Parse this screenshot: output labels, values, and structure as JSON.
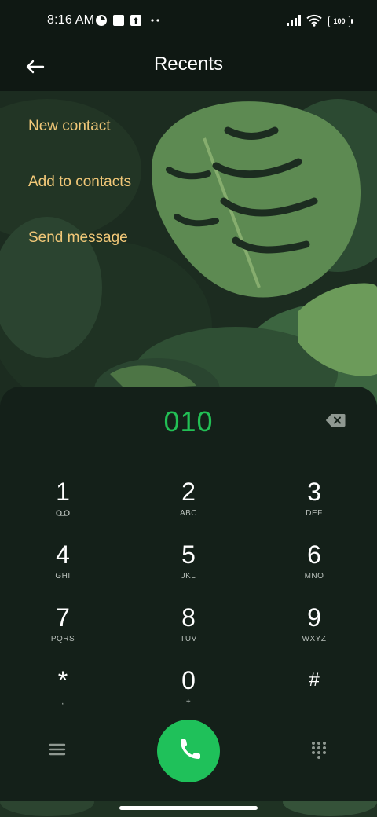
{
  "status_bar": {
    "time": "8:16 AM",
    "battery": "100",
    "icons": [
      "app-notification-icon",
      "square-notification-icon",
      "upload-icon",
      "more-dots-icon",
      "signal-icon",
      "wifi-icon",
      "battery-icon"
    ]
  },
  "header": {
    "title": "Recents",
    "back_icon": "arrow-left-icon"
  },
  "actions": [
    {
      "label": "New contact"
    },
    {
      "label": "Add to contacts"
    },
    {
      "label": "Send message"
    }
  ],
  "dialer": {
    "number": "010",
    "keys": [
      {
        "digit": "1",
        "sub": ""
      },
      {
        "digit": "2",
        "sub": "ABC"
      },
      {
        "digit": "3",
        "sub": "DEF"
      },
      {
        "digit": "4",
        "sub": "GHI"
      },
      {
        "digit": "5",
        "sub": "JKL"
      },
      {
        "digit": "6",
        "sub": "MNO"
      },
      {
        "digit": "7",
        "sub": "PQRS"
      },
      {
        "digit": "8",
        "sub": "TUV"
      },
      {
        "digit": "9",
        "sub": "WXYZ"
      },
      {
        "digit": "*",
        "sub": ","
      },
      {
        "digit": "0",
        "sub": "+"
      },
      {
        "digit": "#",
        "sub": ""
      }
    ]
  },
  "colors": {
    "accent_green": "#22c055",
    "call_button": "#1fc15a",
    "action_text": "#f2c878",
    "background": "#142019"
  }
}
